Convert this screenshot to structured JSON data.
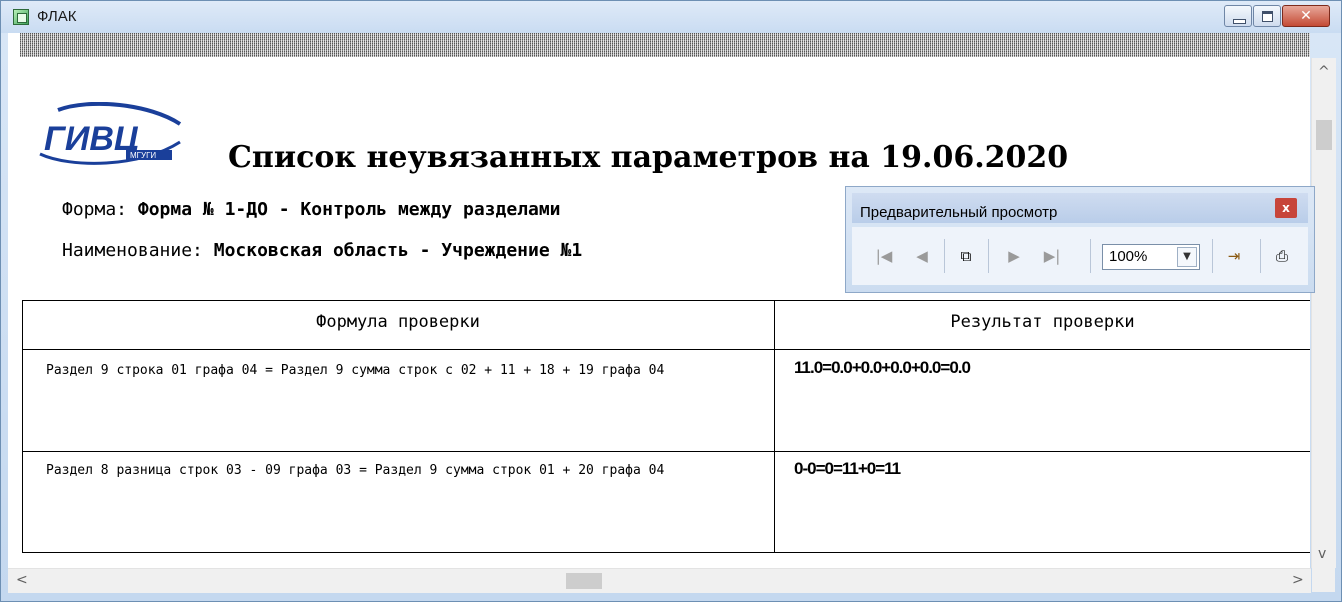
{
  "window": {
    "title": "ФЛАК",
    "buttons": {
      "minimize": "minimize",
      "maximize": "maximize",
      "close": "✕"
    }
  },
  "report": {
    "logo_text": "ГИВЦ",
    "logo_subtext": "МГУГИ",
    "title": "Список неувязанных параметров на  19.06.2020",
    "form_label": "Форма:",
    "form_value": "Форма № 1-ДО - Контроль между разделами",
    "name_label": "Наименование:",
    "name_value": "Московская область - Учреждение №1",
    "columns": [
      "Формула проверки",
      "Результат проверки"
    ],
    "rows": [
      {
        "formula": "Раздел 9 строка 01 графа 04 = Раздел 9 сумма строк с 02 + 11 + 18 + 19 графа 04",
        "result": "11.0=0.0+0.0+0.0+0.0=0.0"
      },
      {
        "formula": "Раздел 8  разница строк 03 - 09 графа 03 = Раздел 9 сумма строк 01 + 20 графа 04",
        "result": "0-0=0=11+0=11"
      }
    ]
  },
  "preview": {
    "title": "Предварительный просмотр",
    "close": "x",
    "zoom": "100%",
    "icons": [
      "first-page-icon",
      "prev-page-icon",
      "copy-pages-icon",
      "next-page-icon",
      "last-page-icon",
      "exit-icon",
      "print-icon"
    ]
  }
}
